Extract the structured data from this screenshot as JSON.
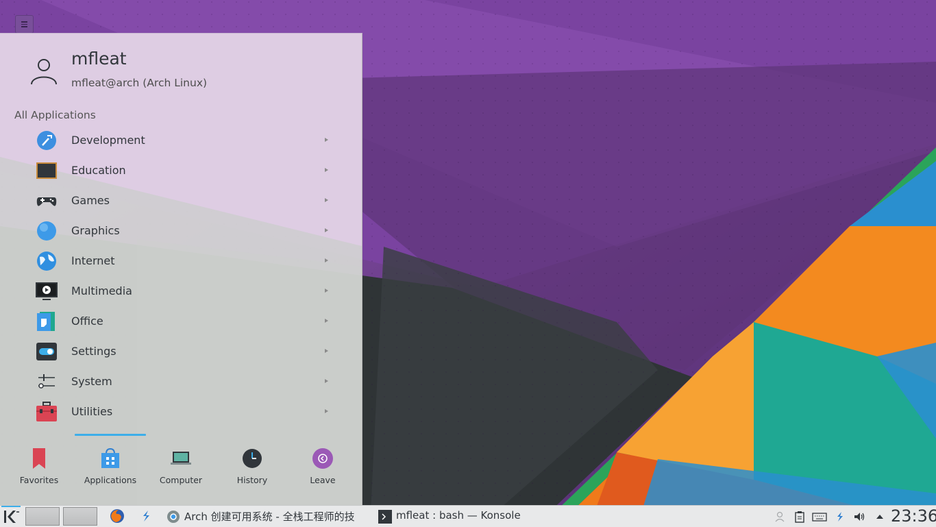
{
  "wallpaper": {
    "colors": [
      "#6a3d8c",
      "#2f3335",
      "#f47d20",
      "#1fa88f",
      "#3b8fd0",
      "#2aa34a"
    ]
  },
  "corner_button": {
    "icon": "hamburger-icon"
  },
  "launcher": {
    "user": {
      "name": "mfleat",
      "host": "mfleat@arch (Arch Linux)",
      "avatar_icon": "user-icon"
    },
    "section_title": "All Applications",
    "categories": [
      {
        "label": "Development",
        "icon": "development-icon"
      },
      {
        "label": "Education",
        "icon": "education-icon"
      },
      {
        "label": "Games",
        "icon": "gamepad-icon"
      },
      {
        "label": "Graphics",
        "icon": "graphics-icon"
      },
      {
        "label": "Internet",
        "icon": "internet-globe-icon"
      },
      {
        "label": "Multimedia",
        "icon": "multimedia-icon"
      },
      {
        "label": "Office",
        "icon": "office-icon"
      },
      {
        "label": "Settings",
        "icon": "settings-toggle-icon"
      },
      {
        "label": "System",
        "icon": "system-sliders-icon"
      },
      {
        "label": "Utilities",
        "icon": "toolbox-icon"
      }
    ],
    "tabs": [
      {
        "label": "Favorites",
        "icon": "bookmark-icon"
      },
      {
        "label": "Applications",
        "icon": "applications-bag-icon"
      },
      {
        "label": "Computer",
        "icon": "laptop-icon"
      },
      {
        "label": "History",
        "icon": "clock-icon"
      },
      {
        "label": "Leave",
        "icon": "leave-icon"
      }
    ],
    "active_tab": "Applications",
    "accent": "#3daee9"
  },
  "taskbar": {
    "tasks": [
      {
        "label": "Arch 创建可用系统 - 全栈工程师的技",
        "icon": "chromium-icon"
      },
      {
        "label": "mfleat : bash — Konsole",
        "icon": "terminal-icon"
      }
    ],
    "tray_icons": [
      "user-switch-icon",
      "clipboard-icon",
      "keyboard-icon",
      "updates-icon",
      "volume-icon",
      "expand-tray-icon"
    ],
    "clock": "23:36"
  }
}
